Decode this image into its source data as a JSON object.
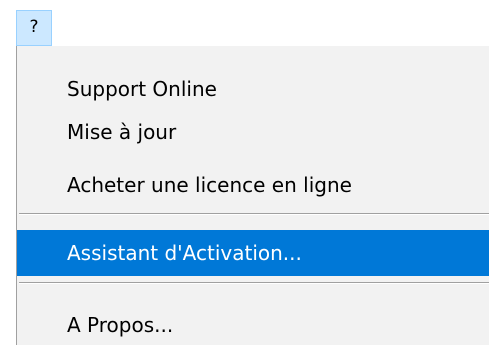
{
  "menubar": {
    "help_label": "?"
  },
  "menu": {
    "items": [
      {
        "label": "Support Online"
      },
      {
        "label": "Mise à jour"
      },
      {
        "label": "Acheter une licence en ligne"
      },
      {
        "label": "Assistant d'Activation...",
        "highlighted": true
      },
      {
        "label": "A Propos..."
      }
    ]
  },
  "colors": {
    "highlight": "#0078d7",
    "menubar_hover": "#cce8ff",
    "menu_background": "#f2f2f2",
    "separator": "#a0a0a0"
  }
}
